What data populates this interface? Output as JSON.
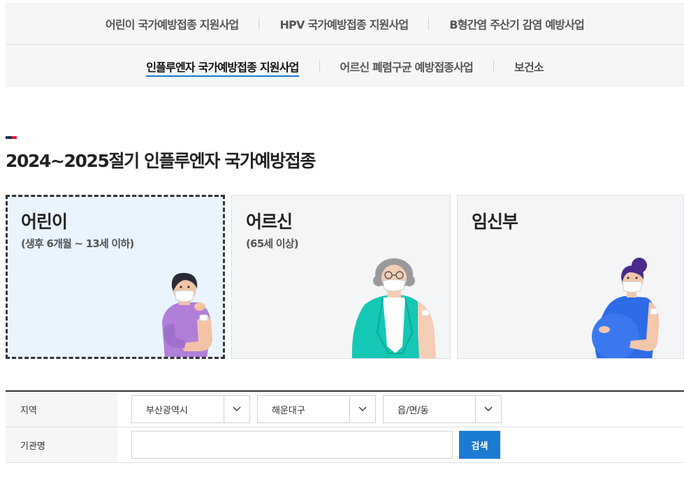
{
  "nav": {
    "row1": [
      "어린이 국가예방접종 지원사업",
      "HPV 국가예방접종 지원사업",
      "B형간염 주산기 감염 예방사업"
    ],
    "row2": [
      "인플루엔자 국가예방접종 지원사업",
      "어르신 폐렴구균 예방접종사업",
      "보건소"
    ],
    "active": "인플루엔자 국가예방접종 지원사업"
  },
  "section": {
    "title": "2024~2025절기 인플루엔자 국가예방접종"
  },
  "cards": [
    {
      "title": "어린이",
      "subtitle": "(생후 6개월 ~ 13세 이하)",
      "icon": "child-vaccination-illustration"
    },
    {
      "title": "어르신",
      "subtitle": "(65세 이상)",
      "icon": "senior-vaccination-illustration"
    },
    {
      "title": "임신부",
      "subtitle": "",
      "icon": "pregnant-vaccination-illustration"
    }
  ],
  "form": {
    "region_label": "지역",
    "institution_label": "기관명",
    "selects": [
      "부산광역시",
      "해운대구",
      "읍/면/동"
    ],
    "institution_value": "",
    "search_label": "검색"
  },
  "colors": {
    "accent": "#1b7ad1",
    "mark_navy": "#1f2d54",
    "mark_red": "#d8212e"
  }
}
